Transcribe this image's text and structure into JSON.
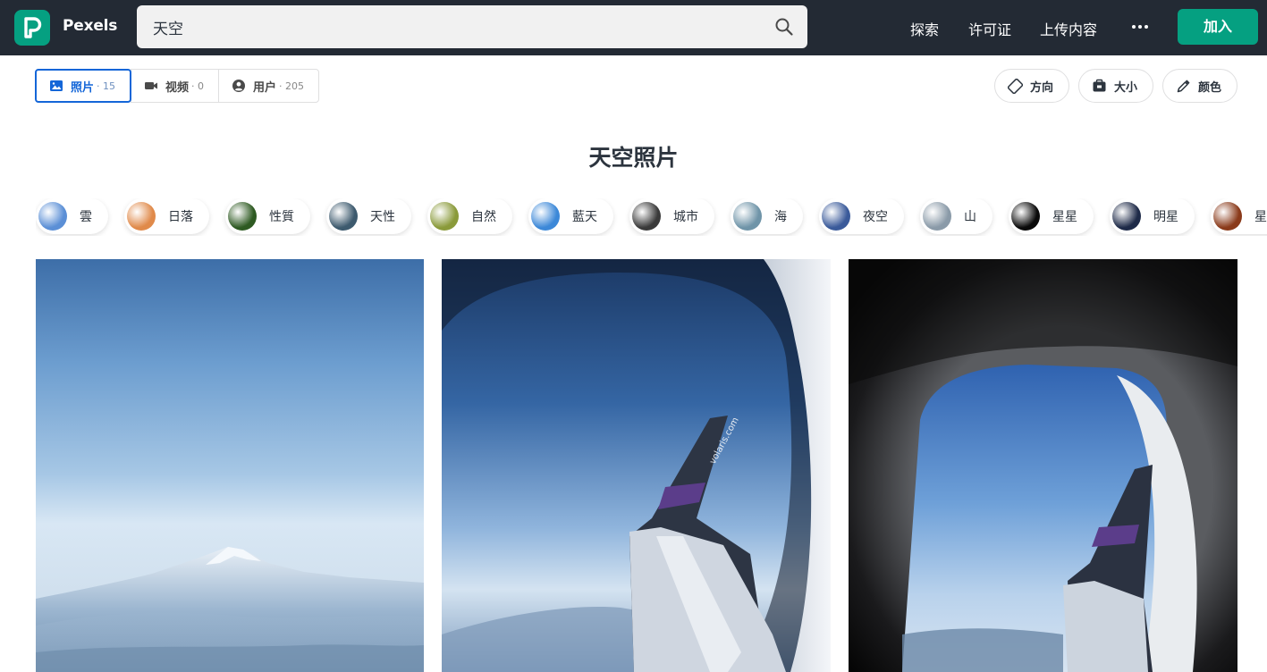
{
  "header": {
    "brand": "Pexels",
    "search": {
      "value": "天空",
      "placeholder": "天空"
    },
    "nav": {
      "explore": "探索",
      "license": "许可证",
      "upload": "上传内容"
    },
    "join_label": "加入"
  },
  "tabs": [
    {
      "label": "照片",
      "count": "· 15",
      "icon": "image-icon",
      "active": true
    },
    {
      "label": "视频",
      "count": "· 0",
      "icon": "video-icon",
      "active": false
    },
    {
      "label": "用户",
      "count": "· 205",
      "icon": "user-icon",
      "active": false
    }
  ],
  "filters": [
    {
      "label": "方向",
      "icon": "orientation-icon"
    },
    {
      "label": "大小",
      "icon": "size-icon"
    },
    {
      "label": "颜色",
      "icon": "color-picker-icon"
    }
  ],
  "page_title": "天空照片",
  "related_searches": [
    {
      "label": "雲",
      "color": "#5b8fd6"
    },
    {
      "label": "日落",
      "color": "#e08a4a"
    },
    {
      "label": "性質",
      "color": "#2e5a22"
    },
    {
      "label": "天性",
      "color": "#3d5a6e"
    },
    {
      "label": "自然",
      "color": "#8a9a3a"
    },
    {
      "label": "藍天",
      "color": "#3c88d8"
    },
    {
      "label": "城市",
      "color": "#3a3a3a"
    },
    {
      "label": "海",
      "color": "#6f94a8"
    },
    {
      "label": "夜空",
      "color": "#3a5a9a"
    },
    {
      "label": "山",
      "color": "#8a9aa8"
    },
    {
      "label": "星星",
      "color": "#0a0a0a"
    },
    {
      "label": "明星",
      "color": "#1e2a48"
    },
    {
      "label": "星形",
      "color": "#8a3a1a"
    }
  ],
  "colors": {
    "accent": "#05a081",
    "header_bg": "#232a34",
    "active_tab": "#1466d8"
  }
}
